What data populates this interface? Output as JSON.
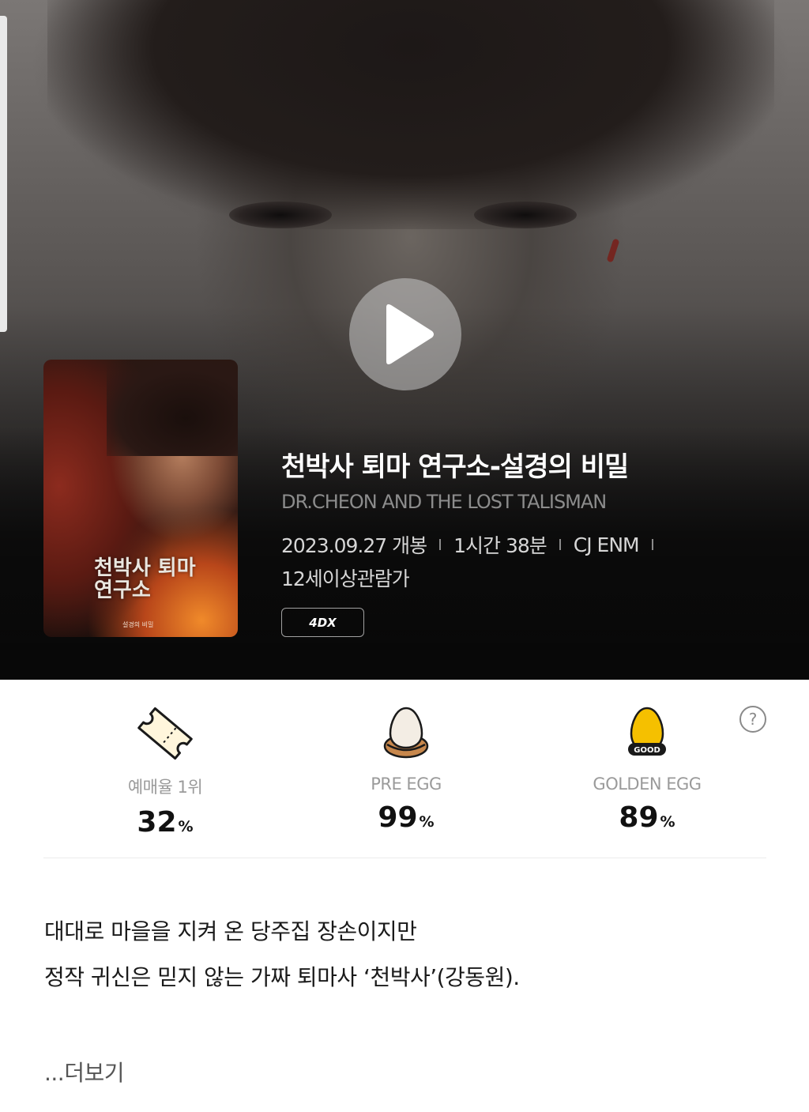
{
  "movie": {
    "title": "천박사 퇴마 연구소-설경의 비밀",
    "eng_title": "DR.CHEON AND THE LOST TALISMAN",
    "release": "2023.09.27 개봉",
    "runtime": "1시간 38분",
    "distributor": "CJ ENM",
    "age_rating": "12세이상관람가",
    "format_badge": "4DX",
    "poster_title": "천박사 퇴마 연구소",
    "poster_credit": "설경의 비밀"
  },
  "stats": [
    {
      "icon": "ticket-icon",
      "label": "예매율 1위",
      "value": "32",
      "unit": "%"
    },
    {
      "icon": "egg-icon",
      "label": "PRE EGG",
      "value": "99",
      "unit": "%"
    },
    {
      "icon": "golden-egg-icon",
      "label": "GOLDEN EGG",
      "value": "89",
      "unit": "%",
      "badge": "GOOD"
    }
  ],
  "help": "?",
  "synopsis": [
    "대대로 마을을 지켜 온 당주집 장손이지만",
    "정작 귀신은 믿지 않는 가짜 퇴마사 ‘천박사’(강동원)."
  ],
  "more_label": "...더보기",
  "colors": {
    "golden_egg": "#f5c000",
    "egg": "#f3ede4",
    "nest": "#c7874c"
  }
}
